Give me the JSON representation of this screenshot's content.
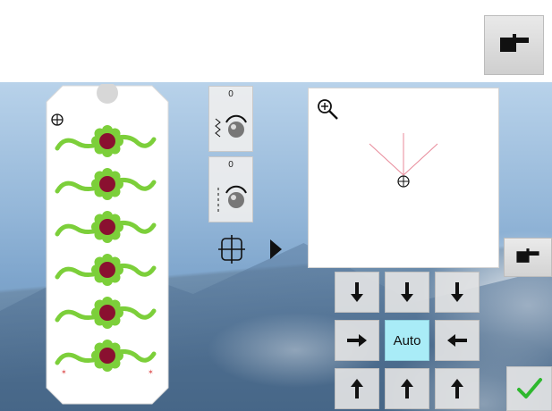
{
  "colors": {
    "auto_bg": "#a9ecf7",
    "check_green": "#2eb82e",
    "motif_green": "#7ccf3a",
    "motif_center": "#8a1030",
    "crosshair_lines": "#e88a9a"
  },
  "top_toolbar": {
    "hand_icon": "pointing-hand-icon"
  },
  "hoop": {
    "motif_count": 6,
    "icons": [
      "crosshair-icon",
      "flower-motif"
    ]
  },
  "controls": {
    "knob_width": {
      "value": "0",
      "icon": "zigzag-width-knob-icon"
    },
    "knob_length": {
      "value": "0",
      "icon": "stitch-length-knob-icon"
    },
    "center_icon": "center-position-icon",
    "arrow_icon": "play-arrow-icon"
  },
  "preview": {
    "zoom_icon": "zoom-in-icon",
    "crosshair_icon": "crosshair-target-icon"
  },
  "side_hand_icon": "pointing-hand-icon",
  "move_grid": {
    "auto_label": "Auto",
    "buttons": [
      "arrow-down",
      "arrow-down",
      "arrow-down",
      "arrow-right",
      "auto",
      "arrow-left",
      "arrow-up",
      "arrow-up",
      "arrow-up"
    ]
  },
  "confirm_icon": "checkmark-icon"
}
